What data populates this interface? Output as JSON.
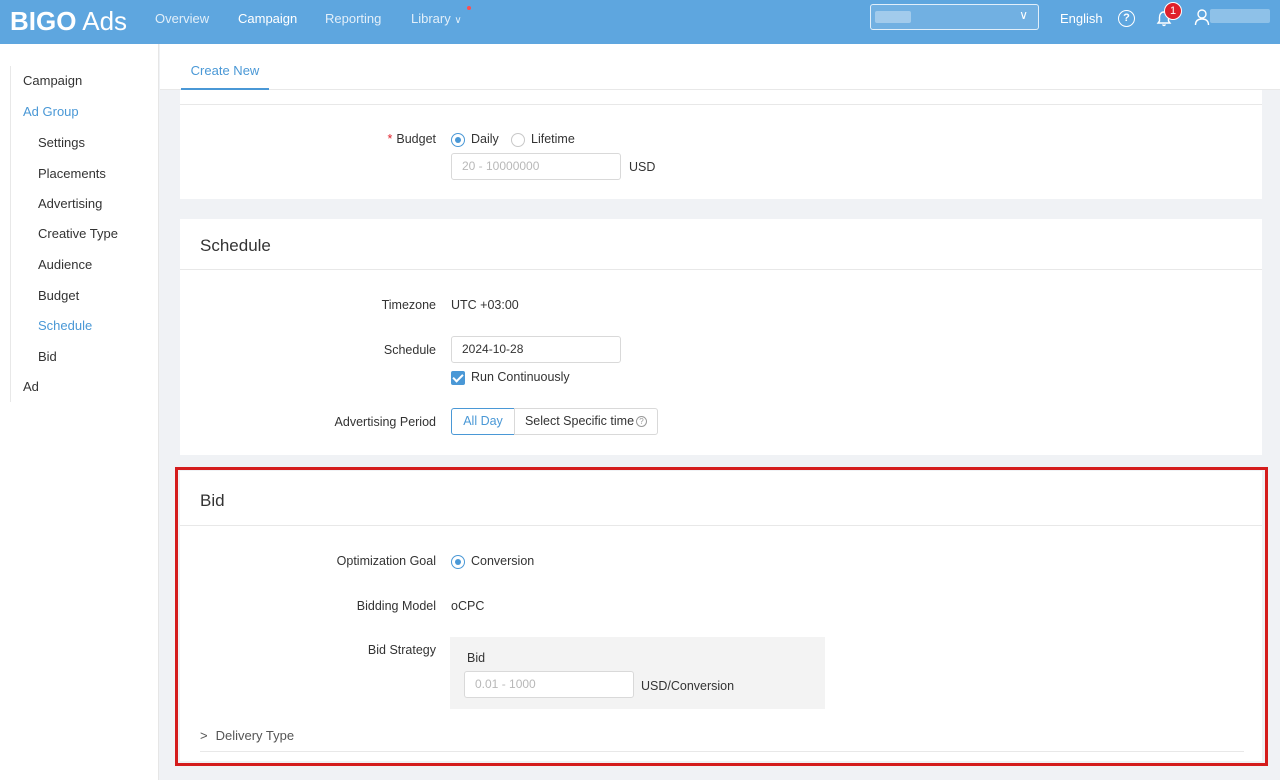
{
  "app": {
    "logo_bold": "BIGO",
    "logo_light": " Ads"
  },
  "nav": {
    "items": [
      "Overview",
      "Campaign",
      "Reporting",
      "Library"
    ],
    "active": "Campaign",
    "language": "English",
    "notification_count": "1"
  },
  "sidebar": {
    "items": [
      {
        "label": "Campaign"
      },
      {
        "label": "Ad Group"
      },
      {
        "label": "Settings"
      },
      {
        "label": "Placements"
      },
      {
        "label": "Advertising"
      },
      {
        "label": "Creative Type"
      },
      {
        "label": "Audience"
      },
      {
        "label": "Budget"
      },
      {
        "label": "Schedule"
      },
      {
        "label": "Bid"
      },
      {
        "label": "Ad"
      }
    ]
  },
  "tabs": {
    "create_new": "Create New"
  },
  "budget": {
    "label": "Budget",
    "required_mark": "*",
    "option_daily": "Daily",
    "option_lifetime": "Lifetime",
    "selected": "Daily",
    "placeholder": "20 - 10000000",
    "currency": "USD"
  },
  "schedule": {
    "title": "Schedule",
    "timezone_label": "Timezone",
    "timezone_value": "UTC +03:00",
    "schedule_label": "Schedule",
    "schedule_value": "2024-10-28",
    "run_continuously": "Run Continuously",
    "run_continuously_checked": true,
    "period_label": "Advertising Period",
    "period_all_day": "All Day",
    "period_specific": "Select Specific time",
    "period_selected": "All Day"
  },
  "bid": {
    "title": "Bid",
    "goal_label": "Optimization Goal",
    "goal_value": "Conversion",
    "model_label": "Bidding Model",
    "model_value": "oCPC",
    "strategy_label": "Bid Strategy",
    "bid_label": "Bid",
    "bid_placeholder": "0.01 - 1000",
    "bid_unit": "USD/Conversion",
    "delivery_type": "Delivery Type"
  },
  "colors": {
    "nav_bg": "#5ea6df",
    "accent": "#4a98d6",
    "highlight_border": "#d41c1c",
    "required": "#e0202a"
  }
}
